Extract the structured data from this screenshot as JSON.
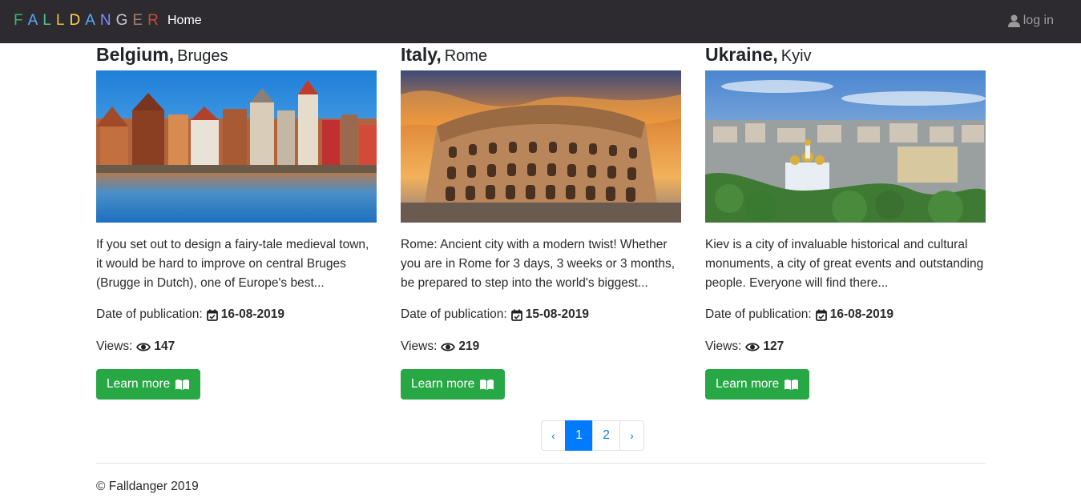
{
  "navbar": {
    "brand_letters": [
      {
        "char": "F",
        "color": "#3cb371"
      },
      {
        "char": "A",
        "color": "#58a8ff"
      },
      {
        "char": "L",
        "color": "#55c08a"
      },
      {
        "char": "L",
        "color": "#e8c23a"
      },
      {
        "char": "D",
        "color": "#ffd84a"
      },
      {
        "char": "A",
        "color": "#5aa9ff"
      },
      {
        "char": "N",
        "color": "#7b8cff"
      },
      {
        "char": "G",
        "color": "#c9c9c9"
      },
      {
        "char": "E",
        "color": "#9b8070"
      },
      {
        "char": "R",
        "color": "#c0503a"
      }
    ],
    "home_label": "Home",
    "login_label": "log in"
  },
  "cards": [
    {
      "country": "Belgium,",
      "city": "Bruges",
      "description": "If you set out to design a fairy-tale medieval town, it would be hard to improve on central Bruges (Brugge in Dutch), one of Europe's best...",
      "date_label": "Date of publication:",
      "date": "16-08-2019",
      "views_label": "Views:",
      "views": "147",
      "button_label": "Learn more"
    },
    {
      "country": "Italy,",
      "city": "Rome",
      "description": "Rome: Ancient city with a modern twist! Whether you are in Rome for 3 days, 3 weeks or 3 months, be prepared to step into the world's biggest...",
      "date_label": "Date of publication:",
      "date": "15-08-2019",
      "views_label": "Views:",
      "views": "219",
      "button_label": "Learn more"
    },
    {
      "country": "Ukraine,",
      "city": "Kyiv",
      "description": "Kiev is a city of invaluable historical and cultural monuments, a city of great events and outstanding people. Everyone will find there...",
      "date_label": "Date of publication:",
      "date": "16-08-2019",
      "views_label": "Views:",
      "views": "127",
      "button_label": "Learn more"
    }
  ],
  "pagination": {
    "prev": "‹",
    "pages": [
      "1",
      "2"
    ],
    "active_page": "1",
    "next": "›"
  },
  "footer": {
    "text": "© Falldanger 2019"
  },
  "colors": {
    "navbar_bg": "#2d2b2f",
    "button_green": "#28a745",
    "link_blue": "#007bff"
  }
}
